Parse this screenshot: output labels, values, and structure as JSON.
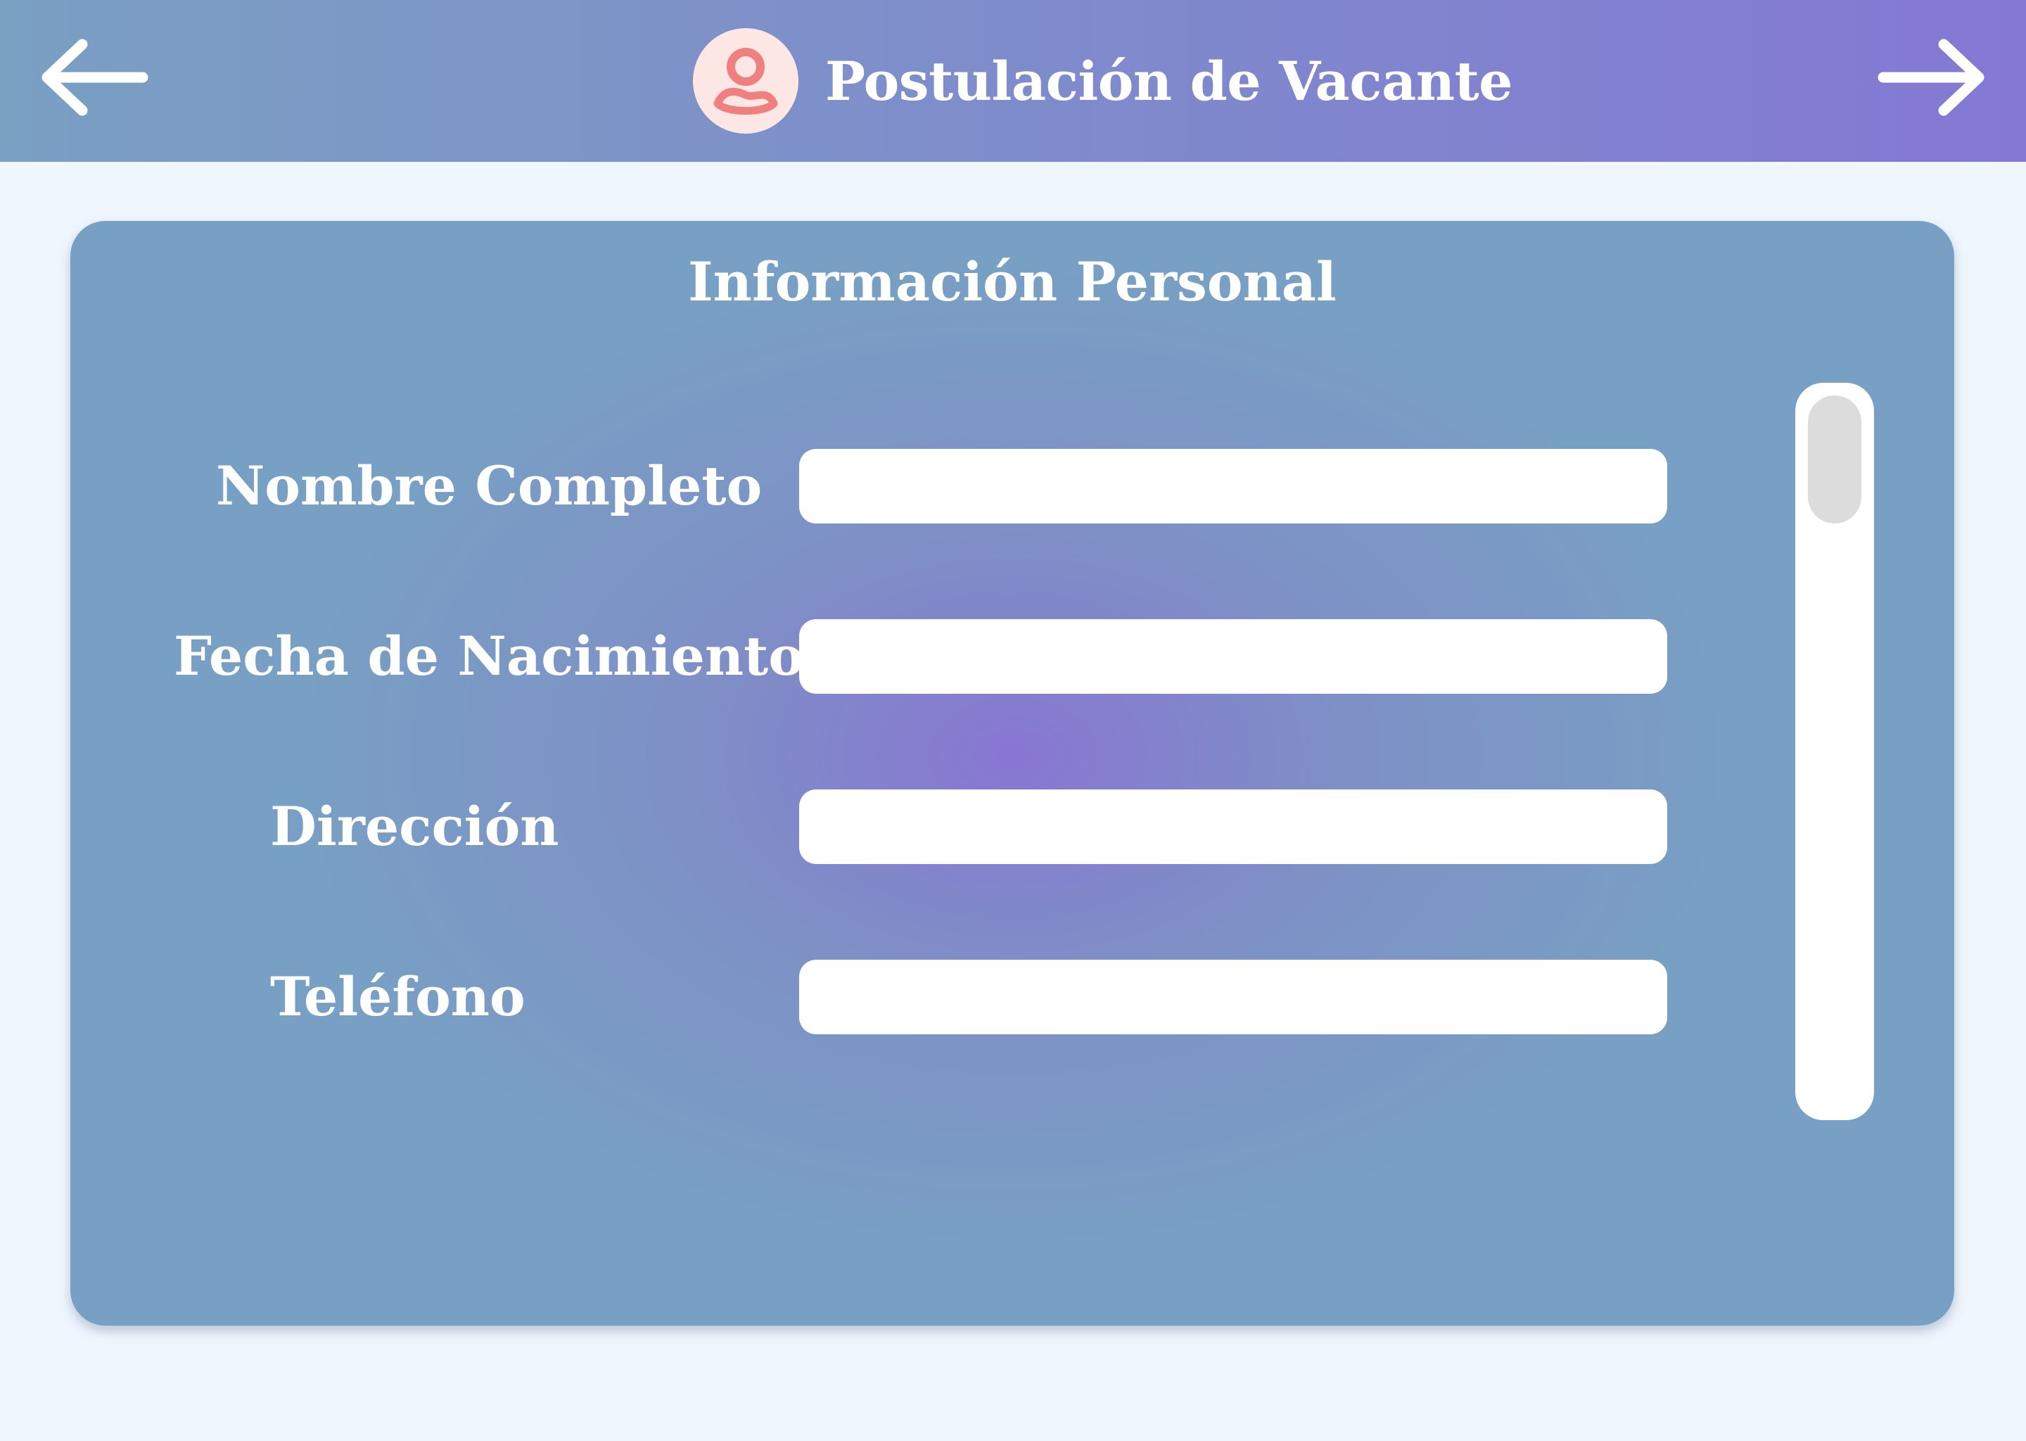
{
  "header": {
    "title": "Postulación de Vacante",
    "back_icon": "arrow-left-icon",
    "forward_icon": "arrow-right-icon",
    "avatar_icon": "user-avatar-icon",
    "gradient_start": "#7aa0c2",
    "gradient_end": "#8478d4"
  },
  "form": {
    "section_title": "Información Personal",
    "fields": [
      {
        "label": "Nombre Completo",
        "value": "",
        "placeholder": ""
      },
      {
        "label": "Fecha de Nacimiento",
        "value": "",
        "placeholder": ""
      },
      {
        "label": "Dirección",
        "value": "",
        "placeholder": ""
      },
      {
        "label": "Teléfono",
        "value": "",
        "placeholder": ""
      }
    ]
  },
  "colors": {
    "page_background": "#eff6fe",
    "card_center": "#8876d2",
    "card_edge": "#78a0c4",
    "avatar_background": "#fde7e5",
    "avatar_icon": "#f07f80",
    "scroll_thumb": "#dcdcdc"
  }
}
